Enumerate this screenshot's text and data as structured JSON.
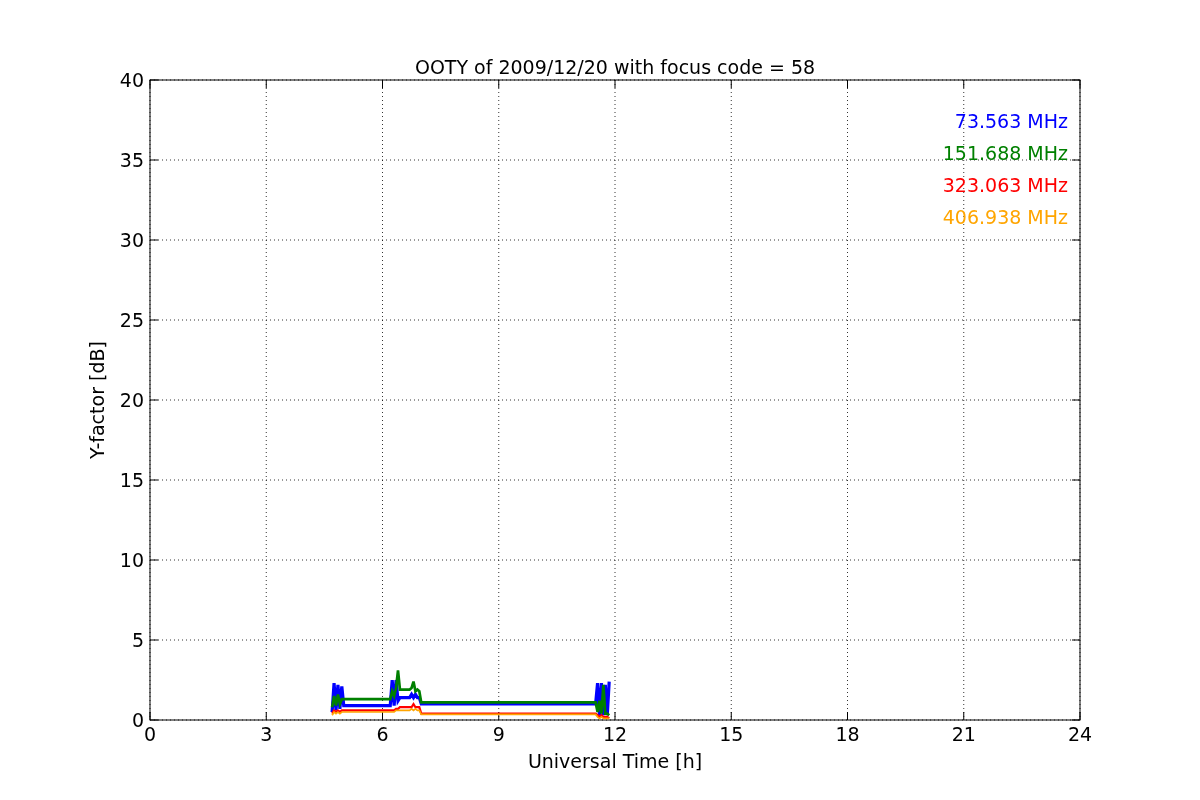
{
  "chart_data": {
    "type": "line",
    "grid": true,
    "title": "OOTY of 2009/12/20 with focus code = 58",
    "xlabel": "Universal Time [h]",
    "ylabel": "Y-factor [dB]",
    "xlim": [
      0,
      24
    ],
    "ylim": [
      0,
      40
    ],
    "xticks": [
      0,
      3,
      6,
      9,
      12,
      15,
      18,
      21,
      24
    ],
    "yticks": [
      0,
      5,
      10,
      15,
      20,
      25,
      30,
      35,
      40
    ],
    "x": [
      4.7,
      4.75,
      4.8,
      4.85,
      4.9,
      4.95,
      5.0,
      6.2,
      6.25,
      6.3,
      6.35,
      6.4,
      6.45,
      6.5,
      6.7,
      6.75,
      6.8,
      6.85,
      6.9,
      6.95,
      7.0,
      11.5,
      11.55,
      11.6,
      11.65,
      11.7,
      11.75,
      11.8,
      11.85
    ],
    "series": [
      {
        "name": "73.563 MHz",
        "color": "#0000ff",
        "values": [
          0.5,
          2.3,
          0.6,
          2.2,
          0.7,
          2.1,
          0.9,
          0.9,
          2.5,
          0.9,
          2.5,
          1.2,
          1.4,
          1.4,
          1.4,
          1.6,
          1.4,
          1.6,
          1.4,
          1.4,
          1.0,
          1.0,
          2.3,
          0.3,
          2.3,
          0.3,
          2.2,
          0.3,
          2.4
        ]
      },
      {
        "name": "151.688 MHz",
        "color": "#008000",
        "values": [
          0.8,
          1.5,
          0.9,
          1.6,
          1.0,
          1.3,
          1.3,
          1.3,
          1.8,
          1.5,
          2.0,
          3.1,
          1.9,
          1.9,
          1.9,
          2.0,
          2.4,
          1.8,
          1.9,
          1.8,
          1.1,
          1.1,
          0.5,
          1.2,
          0.4,
          2.2,
          0.4,
          0.4,
          0.3
        ]
      },
      {
        "name": "323.063 MHz",
        "color": "#ff0000",
        "values": [
          0.4,
          0.6,
          0.5,
          0.6,
          0.5,
          0.6,
          0.6,
          0.6,
          0.6,
          0.6,
          0.7,
          0.7,
          0.8,
          0.8,
          0.8,
          0.8,
          1.0,
          0.8,
          0.8,
          0.8,
          0.4,
          0.4,
          0.3,
          0.2,
          0.3,
          0.2,
          0.2,
          0.2,
          0.1
        ]
      },
      {
        "name": "406.938 MHz",
        "color": "#ffa500",
        "values": [
          0.3,
          0.5,
          0.4,
          0.5,
          0.4,
          0.5,
          0.5,
          0.5,
          0.5,
          0.5,
          0.6,
          0.6,
          0.6,
          0.6,
          0.6,
          0.7,
          0.6,
          0.7,
          0.6,
          0.6,
          0.35,
          0.35,
          0.2,
          0.1,
          0.2,
          0.1,
          0.1,
          0.1,
          0.1
        ]
      }
    ]
  }
}
